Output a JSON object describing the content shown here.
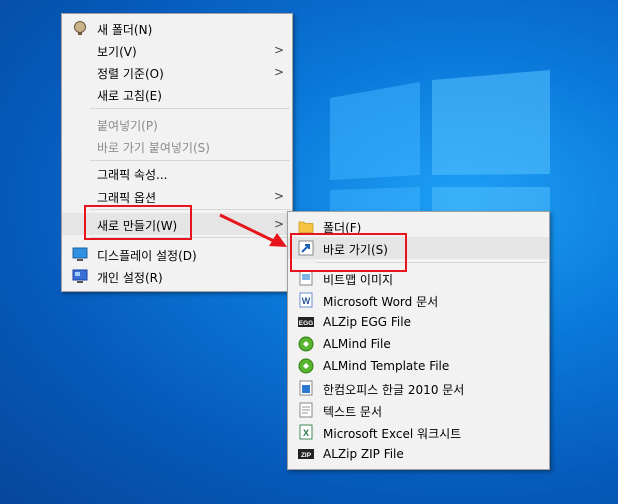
{
  "context_menu": {
    "items": [
      {
        "label": "새 폴더(N)",
        "icon": "new-folder-icon"
      },
      {
        "label": "보기(V)",
        "submenu": true
      },
      {
        "label": "정렬 기준(O)",
        "submenu": true
      },
      {
        "label": "새로 고침(E)"
      },
      {
        "label": "붙여넣기(P)",
        "disabled": true
      },
      {
        "label": "바로 가기 붙여넣기(S)",
        "disabled": true
      },
      {
        "label": "그래픽 속성..."
      },
      {
        "label": "그래픽 옵션",
        "submenu": true
      },
      {
        "label": "새로 만들기(W)",
        "submenu": true,
        "active": true
      },
      {
        "label": "디스플레이 설정(D)",
        "icon": "display-settings-icon"
      },
      {
        "label": "개인 설정(R)",
        "icon": "personalize-icon"
      }
    ],
    "arrow_glyph": ">"
  },
  "submenu": {
    "items": [
      {
        "label": "폴더(F)",
        "icon": "folder-icon"
      },
      {
        "label": "바로 가기(S)",
        "icon": "shortcut-icon"
      },
      {
        "label": "비트맵 이미지",
        "icon": "bitmap-icon"
      },
      {
        "label": "Microsoft Word 문서",
        "icon": "word-doc-icon"
      },
      {
        "label": "ALZip EGG File",
        "icon": "alzip-egg-icon"
      },
      {
        "label": "ALMind File",
        "icon": "almind-icon"
      },
      {
        "label": "ALMind Template File",
        "icon": "almind-template-icon"
      },
      {
        "label": "한컴오피스 한글 2010 문서",
        "icon": "hwp-doc-icon"
      },
      {
        "label": "텍스트 문서",
        "icon": "text-doc-icon"
      },
      {
        "label": "Microsoft Excel 워크시트",
        "icon": "excel-sheet-icon"
      },
      {
        "label": "ALZip ZIP File",
        "icon": "alzip-zip-icon"
      }
    ],
    "icon_text": {
      "egg": "EGG",
      "zip": "ZIP",
      "word": "W",
      "excel": "X"
    }
  },
  "colors": {
    "desktop": "#0a78d9",
    "menu_bg": "#f2f2f2",
    "highlight_box": "#e8141b",
    "folder": "#f5c542",
    "almind": "#58b52f"
  }
}
